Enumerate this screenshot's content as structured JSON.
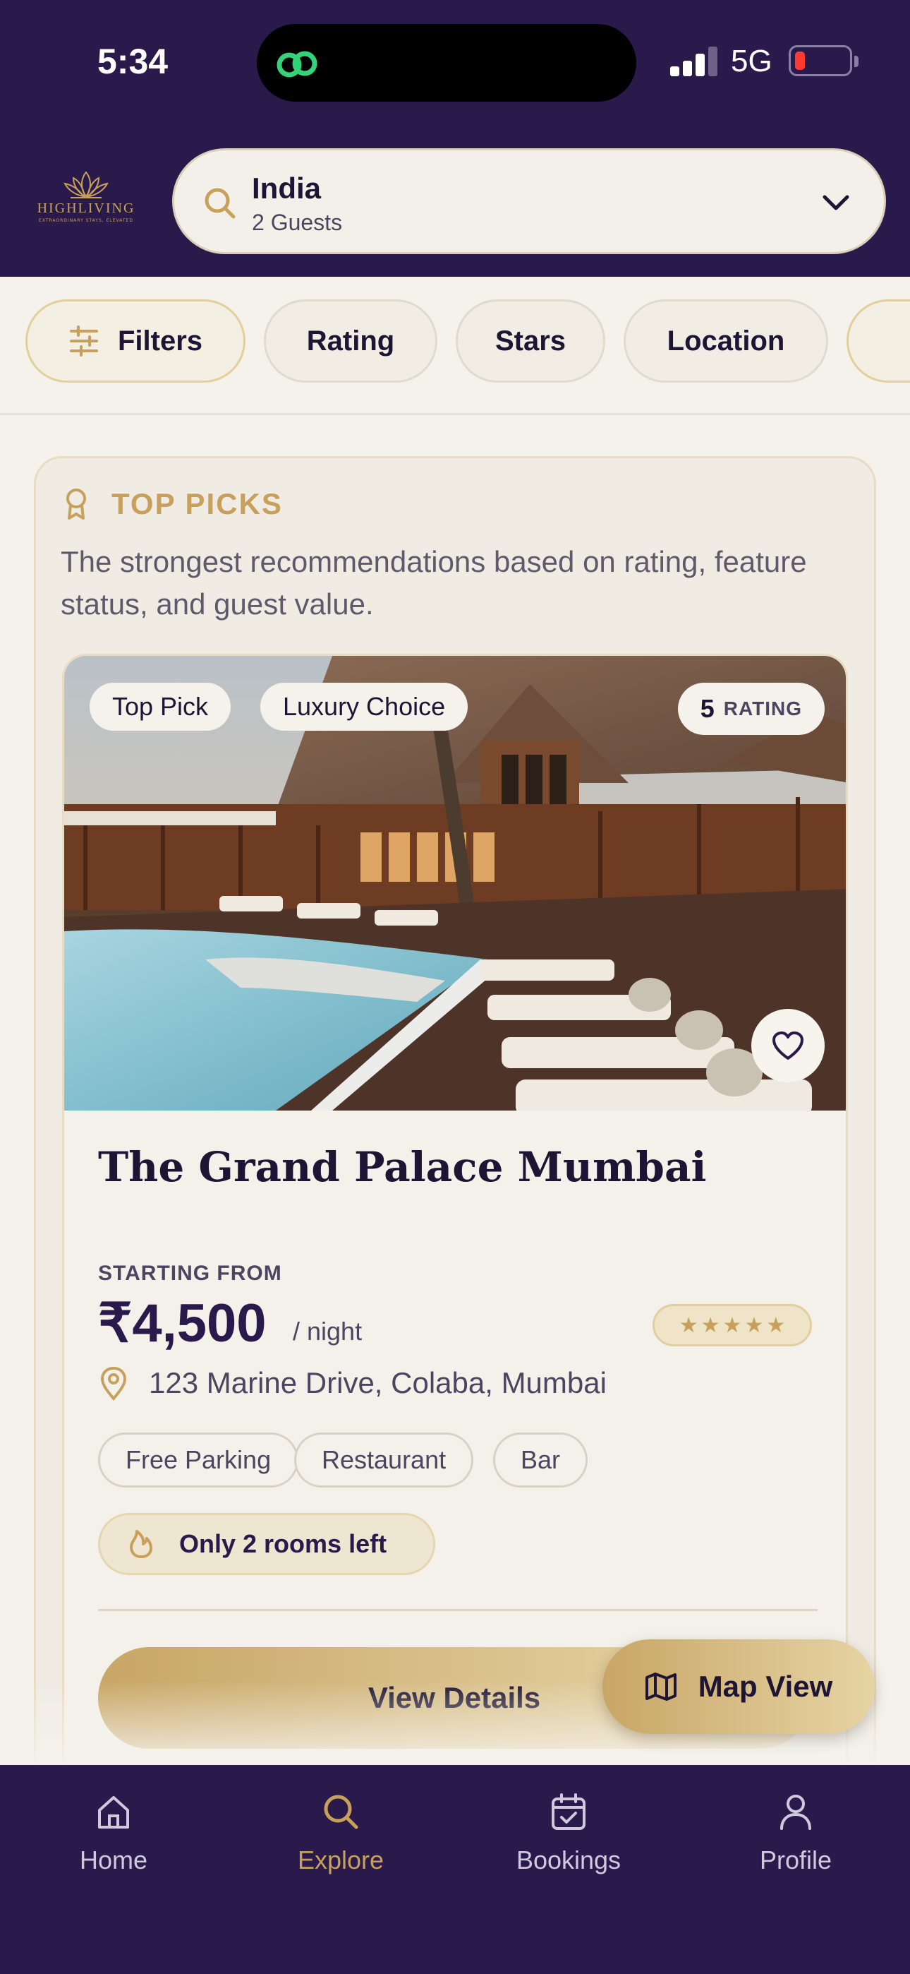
{
  "status_bar": {
    "time": "5:34",
    "network": "5G"
  },
  "brand": {
    "name": "HIGHLIVING",
    "tagline": "EXTRAORDINARY STAYS, ELEVATED"
  },
  "search": {
    "destination": "India",
    "guests": "2 Guests"
  },
  "filters": [
    "Filters",
    "Rating",
    "Stars",
    "Location"
  ],
  "section": {
    "title": "TOP PICKS",
    "description": "The strongest recommendations based on rating, feature status, and guest value."
  },
  "hotel": {
    "badges": [
      "Top Pick",
      "Luxury Choice"
    ],
    "rating_value": "5",
    "rating_label": "RATING",
    "name": "The Grand Palace Mumbai",
    "price_label": "STARTING FROM",
    "price": "₹4,500",
    "price_unit": "/ night",
    "stars": 5,
    "address": "123 Marine Drive, Colaba, Mumbai",
    "amenities": [
      "Free Parking",
      "Restaurant",
      "Bar"
    ],
    "availability": "Only 2 rooms left",
    "cta": "View Details"
  },
  "map_button": "Map View",
  "tabs": [
    {
      "label": "Home",
      "icon": "home-icon",
      "active": false
    },
    {
      "label": "Explore",
      "icon": "search-icon",
      "active": true
    },
    {
      "label": "Bookings",
      "icon": "calendar-icon",
      "active": false
    },
    {
      "label": "Profile",
      "icon": "user-icon",
      "active": false
    }
  ],
  "colors": {
    "primary": "#2a1a4c",
    "accent": "#c7a15c",
    "background": "#f5f2ec"
  }
}
